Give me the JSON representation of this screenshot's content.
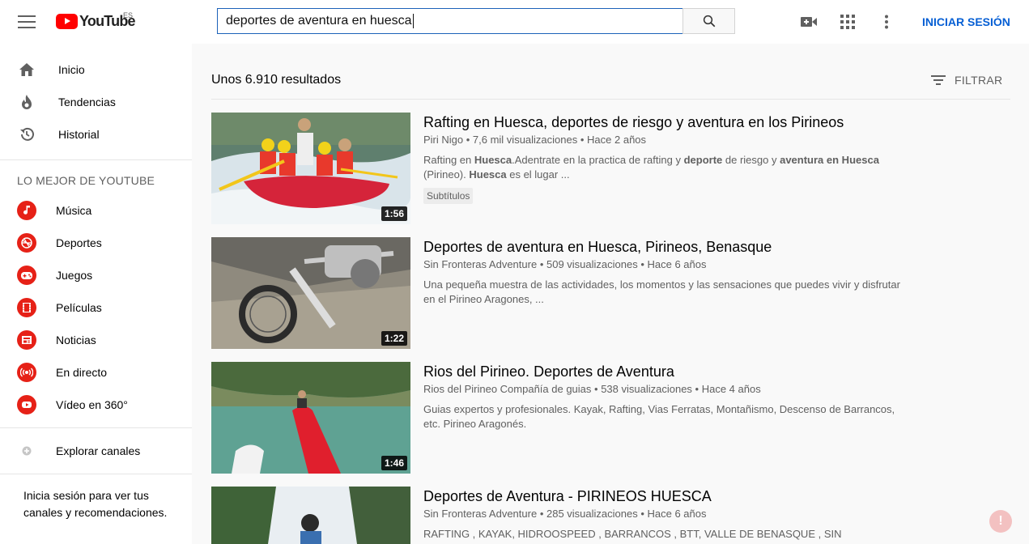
{
  "header": {
    "logo_text": "YouTube",
    "country_code": "ES",
    "search_value": "deportes de aventura en huesca",
    "signin_label": "INICIAR SESIÓN",
    "icons": [
      "menu-icon",
      "search-icon",
      "create-video-icon",
      "apps-icon",
      "more-icon"
    ]
  },
  "sidebar": {
    "main_items": [
      {
        "label": "Inicio",
        "icon": "home-icon"
      },
      {
        "label": "Tendencias",
        "icon": "trending-icon"
      },
      {
        "label": "Historial",
        "icon": "history-icon"
      }
    ],
    "best_title": "LO MEJOR DE YOUTUBE",
    "best_items": [
      {
        "label": "Música",
        "icon": "music-icon"
      },
      {
        "label": "Deportes",
        "icon": "sports-icon"
      },
      {
        "label": "Juegos",
        "icon": "gaming-icon"
      },
      {
        "label": "Películas",
        "icon": "movies-icon"
      },
      {
        "label": "Noticias",
        "icon": "news-icon"
      },
      {
        "label": "En directo",
        "icon": "live-icon"
      },
      {
        "label": "Vídeo en 360°",
        "icon": "video-360-icon"
      }
    ],
    "browse_channels": "Explorar canales",
    "signin_note": "Inicia sesión para ver tus canales y recomendaciones."
  },
  "results": {
    "count_text": "Unos 6.910 resultados",
    "filter_label": "FILTRAR",
    "videos": [
      {
        "title": "Rafting en Huesca, deportes de riesgo y aventura en los Pirineos",
        "channel": "Piri Nigo",
        "views": "7,6 mil visualizaciones",
        "age": "Hace 2 años",
        "desc_parts": [
          "Rafting en ",
          "Huesca",
          ".Adentrate en la practica de rafting y ",
          "deporte",
          " de riesgo y ",
          "aventura en Huesca",
          " (Pirineo). ",
          "Huesca",
          " es el lugar ..."
        ],
        "badge": "Subtítulos",
        "duration": "1:56"
      },
      {
        "title": "Deportes de aventura en Huesca, Pirineos, Benasque",
        "channel": "Sin Fronteras Adventure",
        "views": "509 visualizaciones",
        "age": "Hace 6 años",
        "desc": "Una pequeña muestra de las actividades, los momentos y las sensaciones que puedes vivir y disfrutar en el Pirineo Aragones, ...",
        "duration": "1:22"
      },
      {
        "title": "Rios del Pirineo. Deportes de Aventura",
        "channel": "Rios del Pirineo Compañía de guias",
        "views": "538 visualizaciones",
        "age": "Hace 4 años",
        "desc": "Guias expertos y profesionales. Kayak, Rafting, Vias Ferratas, Montañismo, Descenso de Barrancos, etc. Pirineo Aragonés.",
        "duration": "1:46"
      },
      {
        "title": "Deportes de Aventura - PIRINEOS HUESCA",
        "channel": "Sin Fronteras Adventure",
        "views": "285 visualizaciones",
        "age": "Hace 6 años",
        "desc": "RAFTING , KAYAK, HIDROOSPEED , BARRANCOS , BTT, VALLE DE BENASQUE , SIN FRONTERAS"
      }
    ],
    "meta_separator": " • "
  }
}
